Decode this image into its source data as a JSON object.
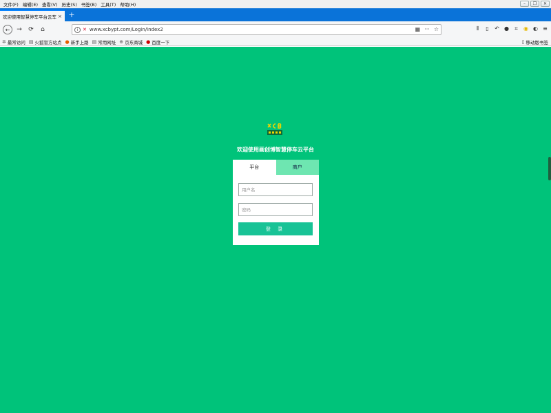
{
  "menu": {
    "items": [
      "文件(F)",
      "编辑(E)",
      "查看(V)",
      "历史(S)",
      "书签(B)",
      "工具(T)",
      "帮助(H)"
    ]
  },
  "tab": {
    "title": "欢迎使用智慧停车平台云车场 - 登录",
    "close": "×"
  },
  "url": {
    "text": "www.xcbypt.com/Login/Index2"
  },
  "bookmarks": {
    "items": [
      {
        "icon": "gear-icon",
        "label": "最常访问"
      },
      {
        "icon": "page-icon",
        "label": "火狐官方站点"
      },
      {
        "icon": "firefox-icon",
        "label": "新手上路"
      },
      {
        "icon": "page-icon",
        "label": "常用网址"
      },
      {
        "icon": "globe-icon",
        "label": "京东商城"
      },
      {
        "icon": "baidu-icon",
        "label": "百度一下"
      }
    ],
    "mobile": "移动版书签"
  },
  "page": {
    "welcome": "欢迎使用画创博智慧停车云平台",
    "tabs": [
      "平台",
      "商户"
    ],
    "username_placeholder": "用户名",
    "password_placeholder": "密码",
    "login_label": "登 录"
  },
  "colors": {
    "background": "#00c37a",
    "button": "#18c396",
    "inactive_tab": "#6ee6b1",
    "tab_strip": "#0a73d9"
  }
}
